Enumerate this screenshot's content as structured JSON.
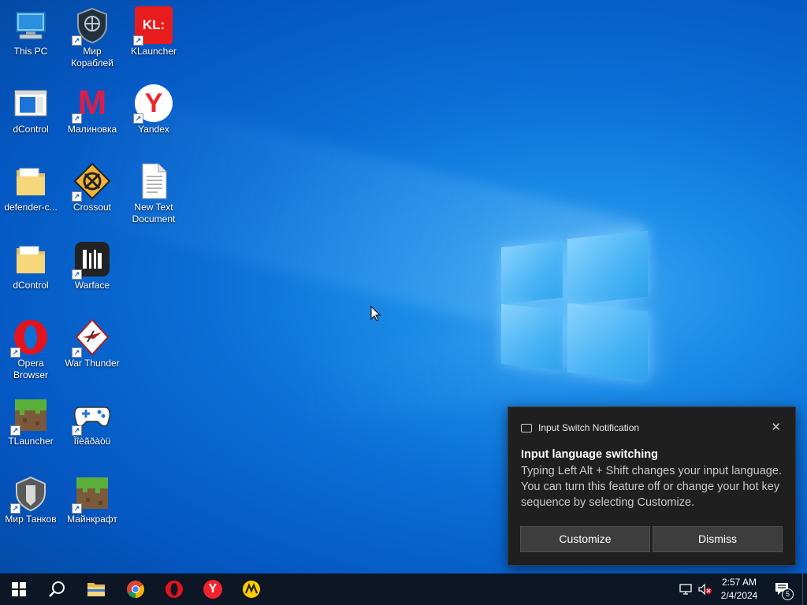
{
  "desktop": {
    "icons": [
      {
        "label": "This PC"
      },
      {
        "label": "Мир Кораблей"
      },
      {
        "label": "KLauncher"
      },
      {
        "label": "dControl"
      },
      {
        "label": "Малиновка"
      },
      {
        "label": "Yandex"
      },
      {
        "label": "defender-c..."
      },
      {
        "label": "Crossout"
      },
      {
        "label": "New Text Document"
      },
      {
        "label": "dControl"
      },
      {
        "label": "Warface"
      },
      {
        "label": "Opera Browser"
      },
      {
        "label": "War Thunder"
      },
      {
        "label": "TLauncher"
      },
      {
        "label": "Ïîèãðàòü"
      },
      {
        "label": "Мир Танков"
      },
      {
        "label": "Майнкрафт"
      }
    ],
    "icon_glyphs": {
      "klauncher": "KL:",
      "malinovka": "M",
      "yandex": "Y",
      "shortcut": "↗"
    }
  },
  "notification": {
    "header": "Input Switch Notification",
    "title": "Input language switching",
    "body": "Typing Left Alt + Shift changes your input language. You can turn this feature off or change your hot key sequence by selecting Customize.",
    "close_glyph": "✕",
    "customize_label": "Customize",
    "dismiss_label": "Dismiss"
  },
  "taskbar": {
    "time": "2:57 AM",
    "date": "2/4/2024",
    "notification_count": "5",
    "apps": [
      "start-button",
      "search",
      "file-explorer",
      "chrome",
      "opera",
      "yandex",
      "yandex-market"
    ]
  },
  "colors": {
    "accent": "#0a6fd6",
    "taskbar": "#0c1624",
    "toast": "#1f1f1f"
  }
}
